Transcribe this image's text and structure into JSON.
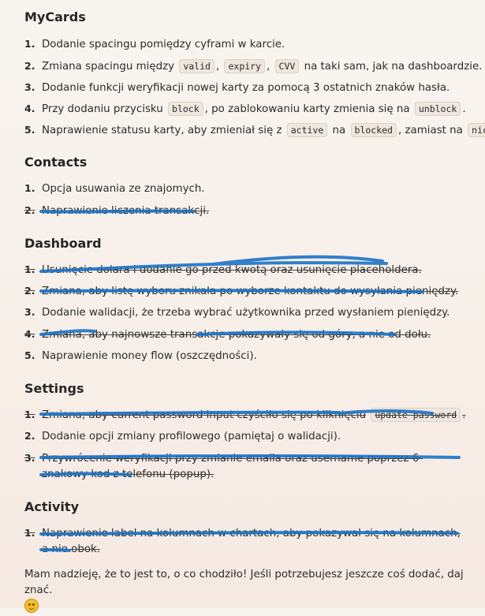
{
  "mycards": {
    "title": "MyCards",
    "items": [
      {
        "num": "1.",
        "text": "Dodanie spacingu pomiędzy cyframi w karcie."
      },
      {
        "num": "2.",
        "pre": "Zmiana spacingu między",
        "c1": "valid",
        "sep1": ",",
        "c2": "expiry",
        "sep2": ",",
        "c3": "CVV",
        "post": "na taki sam, jak na dashboardzie."
      },
      {
        "num": "3.",
        "text": "Dodanie funkcji weryfikacji nowej karty za pomocą 3 ostatnich znaków hasła."
      },
      {
        "num": "4.",
        "pre": "Przy dodaniu przycisku",
        "c1": "block",
        "mid": ", po zablokowaniu karty zmienia się na",
        "c2": "unblock",
        "post": "."
      },
      {
        "num": "5.",
        "pre": "Naprawienie statusu karty, aby zmieniał się z",
        "c1": "active",
        "mid1": "na",
        "c2": "blocked",
        "mid2": ", zamiast na",
        "c3": "nic",
        "post": "."
      }
    ]
  },
  "contacts": {
    "title": "Contacts",
    "items": [
      {
        "num": "1.",
        "text": "Opcja usuwania ze znajomych."
      },
      {
        "num": "2.",
        "text": "Naprawienie liczenia transakcji."
      }
    ]
  },
  "dashboard": {
    "title": "Dashboard",
    "items": [
      {
        "num": "1.",
        "text": "Usunięcie dolara i dodanie go przed kwotą oraz usunięcie placeholdera."
      },
      {
        "num": "2.",
        "text": "Zmiana, aby listę wyboru znikała po wyborze kontaktu do wysyłania pieniędzy."
      },
      {
        "num": "3.",
        "text": "Dodanie walidacji, że trzeba wybrać użytkownika przed wysłaniem pieniędzy."
      },
      {
        "num": "4.",
        "text": "Zmiana, aby najnowsze transakcje pokazywały się od góry, a nie od dołu."
      },
      {
        "num": "5.",
        "text": "Naprawienie money flow (oszczędności)."
      }
    ]
  },
  "settings": {
    "title": "Settings",
    "items": [
      {
        "num": "1.",
        "pre": "Zmiana, aby current password input czyściło się po kliknięciu",
        "c1": "update password",
        "post": "."
      },
      {
        "num": "2.",
        "text": "Dodanie opcji zmiany profilowego (pamiętaj o walidacji)."
      },
      {
        "num": "3.",
        "text": "Przywrócenie weryfikacji przy zmianie emaila oraz username poprzez 6-znakowy kod z telefonu (popup)."
      }
    ]
  },
  "activity": {
    "title": "Activity",
    "items": [
      {
        "num": "1.",
        "text": "Naprawienie label na kolumnach w chartach, aby pokazywał się na kolumnach, a nie obok."
      }
    ]
  },
  "closing": "Mam nadzieję, że to jest to, o co chodziło! Jeśli potrzebujesz jeszcze coś dodać, daj znać.",
  "emoji_icon": "smiling-face-icon",
  "marker_color": "#1a73c8"
}
